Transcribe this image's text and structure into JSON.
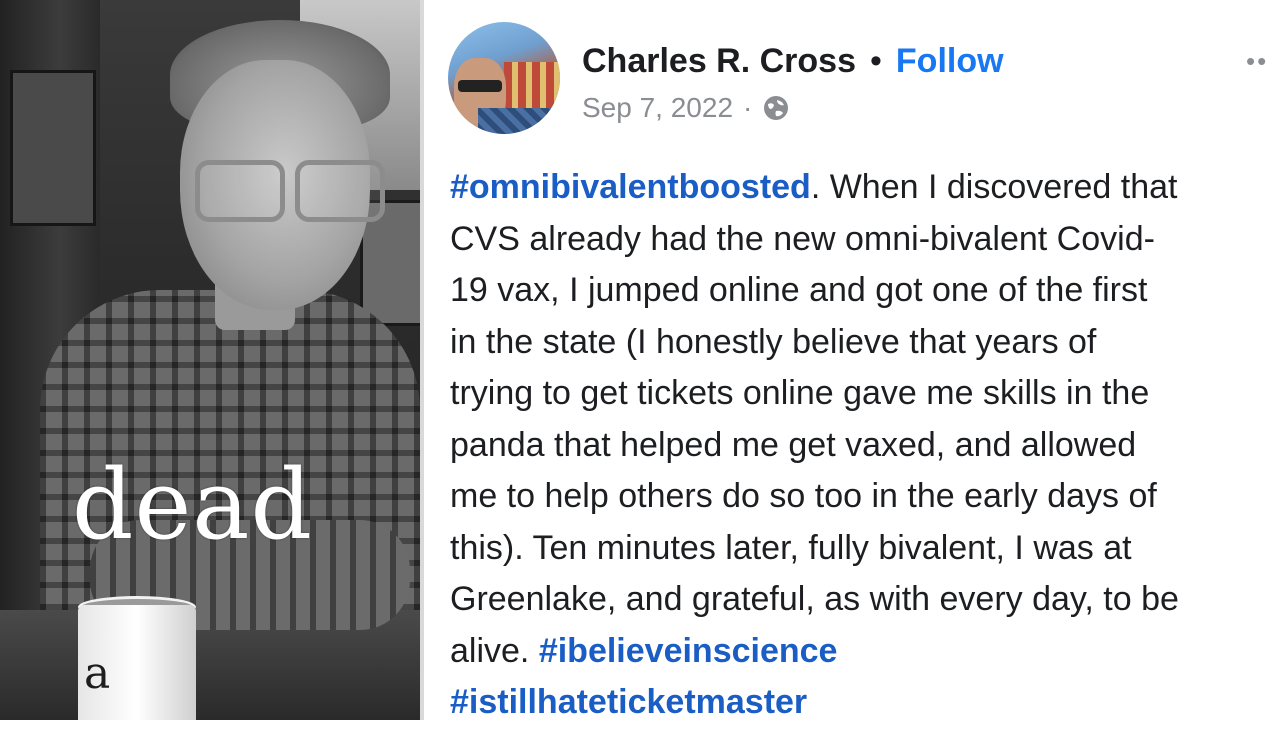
{
  "photo": {
    "overlay_text": "dead",
    "mug_text": "a"
  },
  "post": {
    "author": "Charles R. Cross",
    "separator": "•",
    "follow_label": "Follow",
    "more_icon": "more-dots-icon",
    "date": "Sep 7, 2022",
    "meta_separator": "·",
    "audience_icon": "globe-icon",
    "body_lines": [
      {
        "tag": "#omnibivalentboosted",
        "text": ". When I discovered that"
      },
      {
        "text": "CVS already had the new omni-bivalent Covid-"
      },
      {
        "text": "19 vax, I jumped online and got one of the first"
      },
      {
        "text": "in the state (I honestly believe that years of"
      },
      {
        "text": "trying to get tickets online gave me skills in the"
      },
      {
        "text": "panda that helped me get vaxed, and allowed"
      },
      {
        "text": "me to help others do so too in the early days of"
      },
      {
        "text": "this). Ten minutes later, fully bivalent, I was at"
      },
      {
        "text": "Greenlake, and grateful, as with every day, to be"
      },
      {
        "text": "alive. ",
        "tag_after": "#ibelieveinscience"
      },
      {
        "tag": "#istillhateticketmaster"
      }
    ]
  },
  "colors": {
    "link": "#1a5dc4",
    "follow": "#1877f2",
    "text": "#1c1e21",
    "meta": "#8a8d91"
  }
}
